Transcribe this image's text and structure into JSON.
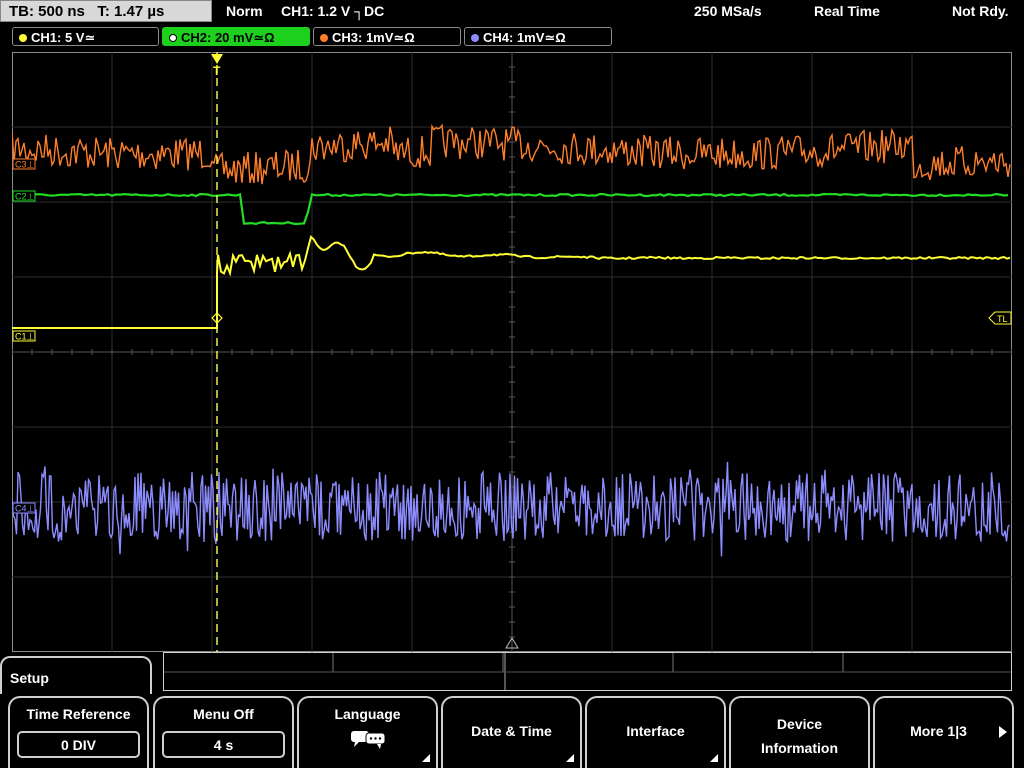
{
  "topbar": {
    "timebase": "TB: 500 ns",
    "trigger_time": "T: 1.47 µs",
    "mode": "Norm",
    "trigger": "CH1: 1.2 V ┐DC",
    "sample_rate": "250 MSa/s",
    "acq_mode": "Real Time",
    "status": "Not Rdy."
  },
  "channels": [
    {
      "label": "CH1: 5 V≃",
      "color": "#ffff33",
      "active": false
    },
    {
      "label": "CH2: 20 mV≃Ω",
      "color": "#22dd22",
      "active": true
    },
    {
      "label": "CH3: 1mV≃Ω",
      "color": "#ff7f2a",
      "active": false
    },
    {
      "label": "CH4: 1mV≃Ω",
      "color": "#8c8cff",
      "active": false
    }
  ],
  "markers": {
    "c1": "C1⊥",
    "c3": "C3⊥",
    "c2": "C2⊥",
    "c4": "C4⊥",
    "tl": "TL",
    "trigger": "T"
  },
  "menu": {
    "title": "Setup",
    "keys": [
      {
        "label": "Time Reference",
        "value": "0 DIV"
      },
      {
        "label": "Menu Off",
        "value": "4 s"
      },
      {
        "label": "Language",
        "icon": "speech-bubble-icon"
      },
      {
        "label": "Date & Time"
      },
      {
        "label": "Interface"
      },
      {
        "label": "Device\nInformation",
        "line1": "Device",
        "line2": "Information"
      },
      {
        "label": "More 1|3"
      }
    ]
  },
  "colors": {
    "ch1": "#ffff33",
    "ch2": "#22dd22",
    "ch3": "#ff7f2a",
    "ch4": "#8c8cff",
    "grid": "#3a3a3a"
  }
}
